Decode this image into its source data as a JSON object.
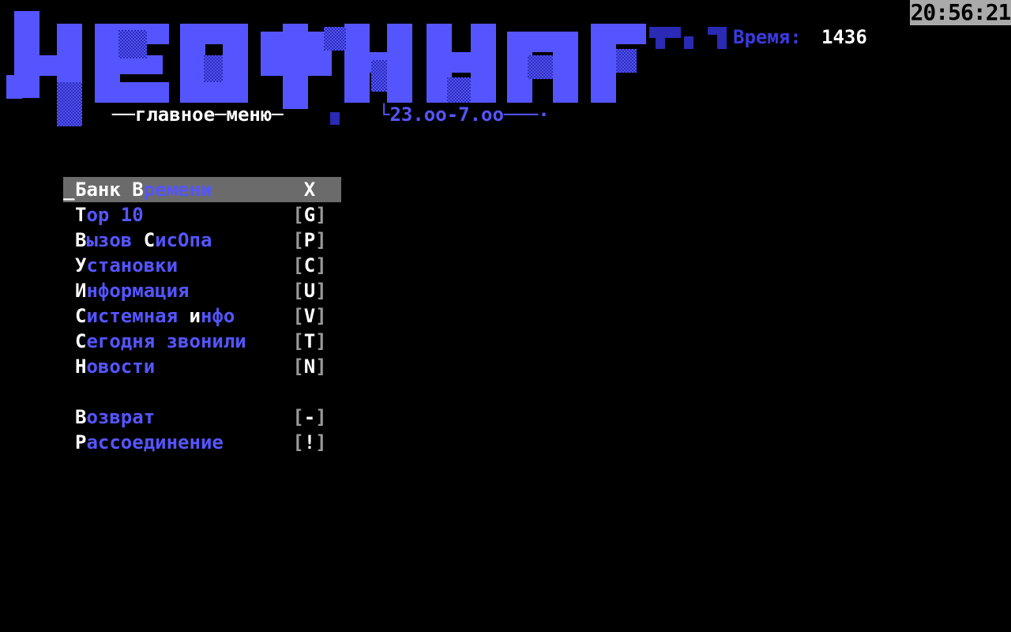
{
  "header": {
    "clock": "20:56:21",
    "time_label": "Время:",
    "time_value": "1436",
    "subtitle": "──главное─меню─",
    "hours": "└23.oo-7.oo───·"
  },
  "colors": {
    "accent": "#5555ff",
    "dark_accent": "#2a2ab4",
    "text": "#ffffff",
    "selection": "#6b6b6b",
    "clock_bg": "#aaaaaa"
  },
  "menu": {
    "cursor": "_",
    "items": [
      {
        "first": "Б",
        "rest": "анк ",
        "hl": "В",
        "tail": "ремени",
        "key": "X",
        "open": "",
        "close": "",
        "selected": true
      },
      {
        "first": "T",
        "rest": "op 10",
        "hl": "",
        "tail": "",
        "key": "G",
        "open": "[",
        "close": "]"
      },
      {
        "first": "В",
        "rest": "ызов ",
        "hl": "С",
        "tail": "исОпа",
        "key": "P",
        "open": "[",
        "close": "]"
      },
      {
        "first": "У",
        "rest": "становки",
        "hl": "",
        "tail": "",
        "key": "C",
        "open": "[",
        "close": "]"
      },
      {
        "first": "И",
        "rest": "нформация",
        "hl": "",
        "tail": "",
        "key": "U",
        "open": "[",
        "close": "]"
      },
      {
        "first": "С",
        "rest": "истемная ",
        "hl": "и",
        "tail": "нфо",
        "key": "V",
        "open": "[",
        "close": "]"
      },
      {
        "first": "С",
        "rest": "егодня звонили",
        "hl": "",
        "tail": "",
        "key": "T",
        "open": "[",
        "close": "]"
      },
      {
        "first": "Н",
        "rest": "овости",
        "hl": "",
        "tail": "",
        "key": "N",
        "open": "[",
        "close": "]"
      },
      {
        "first": "В",
        "rest": "озврат",
        "hl": "",
        "tail": "",
        "key": "-",
        "open": "[",
        "close": "]"
      },
      {
        "first": "Р",
        "rest": "ассоединение",
        "hl": "",
        "tail": "",
        "key": "!",
        "open": "[",
        "close": "]"
      }
    ]
  }
}
